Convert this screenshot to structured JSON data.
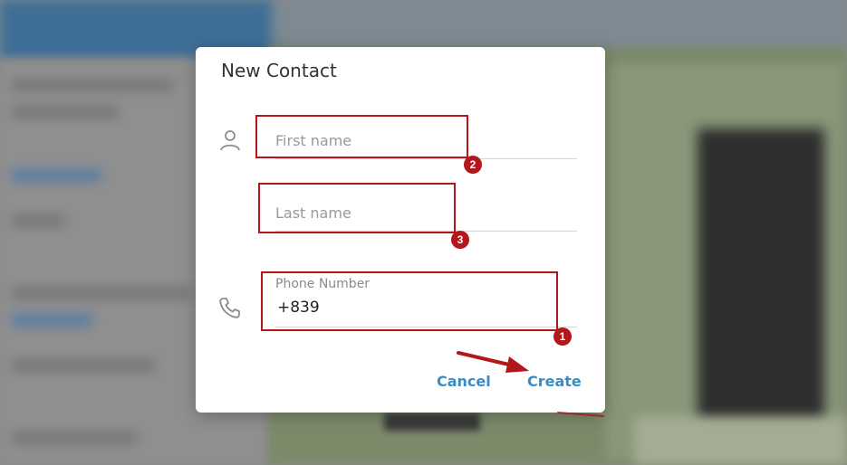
{
  "dialog": {
    "title": "New Contact",
    "first_name": {
      "placeholder": "First name",
      "value": ""
    },
    "last_name": {
      "placeholder": "Last name",
      "value": ""
    },
    "phone": {
      "label": "Phone Number",
      "value": "+839"
    },
    "cancel_label": "Cancel",
    "create_label": "Create"
  },
  "annotations": {
    "phone_step": "1",
    "first_name_step": "2",
    "last_name_step": "3"
  },
  "colors": {
    "accent": "#3a8cc4",
    "annotation": "#b3161b"
  },
  "icons": {
    "first_field": "person-icon",
    "phone_field": "phone-icon"
  }
}
